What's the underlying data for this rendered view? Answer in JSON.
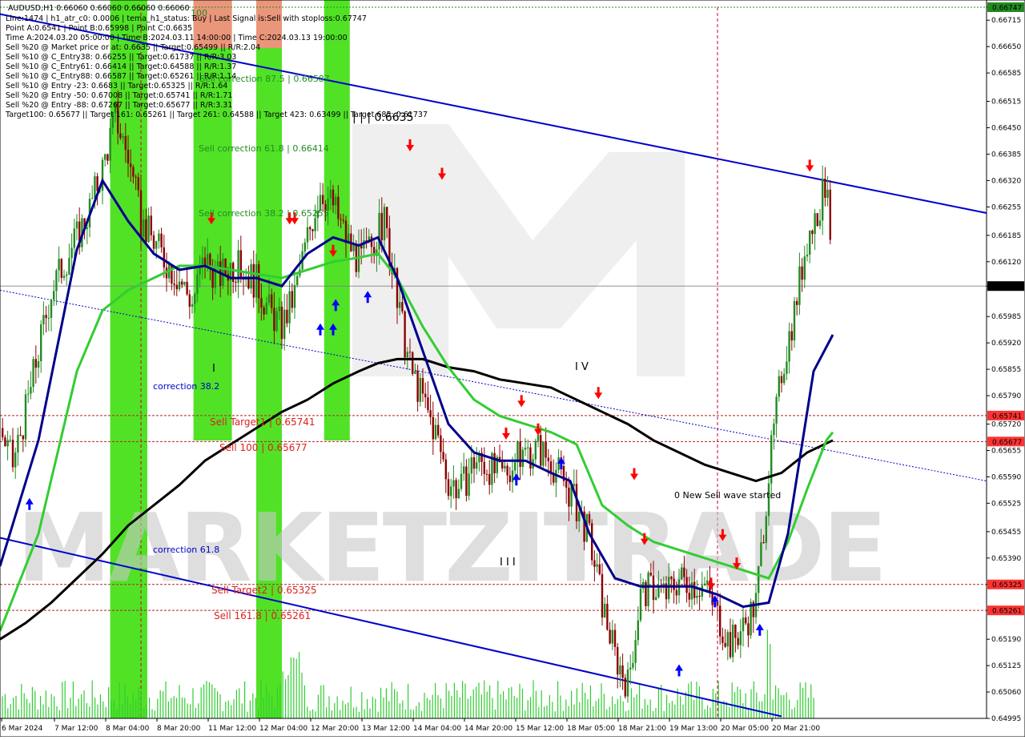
{
  "header": {
    "symbol": "AUDUSD,H1  0.66060 0.66060 0.66060 0.66060",
    "info_lines": [
      "Line:1474 | h1_atr_c0: 0.0006 | tema_h1_status: Buy | Last Signal is:Sell with stoploss:0.67747",
      "Point A:0.6541 | Point B:0.65998 | Point C:0.6635",
      "Time A:2024.03.20 05:00:00 | Time B:2024.03.11 14:00:00 | Time C:2024.03.13 19:00:00",
      "Sell %20 @ Market price or at: 0.6635 || Target:0.65499 || R/R:2.04",
      "Sell %10 @ C_Entry38: 0.66255 || Target:0.61737 || R/R:3.03",
      "Sell %10 @ C_Entry61: 0.66414 || Target:0.64588 || R/R:1.37",
      "Sell %10 @ C_Entry88: 0.66587 || Target:0.65261 || R/R:1.14",
      "Sell %10 @ Entry -23: 0.6683 || Target:0.65325 || R/R:1.64",
      "Sell %20 @ Entry -50: 0.67008 || Target:0.65741 || R/R:1.71",
      "Sell %20 @ Entry -88: 0.67267 || Target:0.65677 || R/R:3.31",
      "Target100: 0.65677 || Target 161: 0.65261 || Target 261: 0.64588 || Target 423: 0.63499 || Target 685: 0.61737"
    ]
  },
  "annotations": {
    "corr_875": "Sell correction 87.5 | 0.66587",
    "corr_618": "Sell correction 61.8 | 0.66414",
    "corr_382": "Sell correction 38.2 | 0.65255",
    "point_c": "| | | 0.6635",
    "label_100": "100",
    "correction_382": "correction 38.2",
    "correction_618": "correction 61.8",
    "sell_target1": "Sell Target1 | 0.65741",
    "sell_100": "Sell 100 | 0.65677",
    "sell_target2": "Sell Target2 | 0.65325",
    "sell_1618": "Sell 161.8 | 0.65261",
    "new_wave": "0 New Sell wave started",
    "wave_i": "I",
    "wave_iii": "I I I",
    "wave_iv": "I V"
  },
  "watermark": "MARKETZITRADE",
  "colors": {
    "up_candle": "#228b22",
    "down_candle": "#8b0000",
    "channel": "#0000cd",
    "green_zone": "#33dd00",
    "orange_zone": "#e9967a",
    "ma_fast": "#00008b",
    "ma_mid": "#32cd32",
    "ma_slow": "#000000",
    "level_line": "#b22222",
    "sell_arrow": "#ff0000",
    "buy_arrow": "#0000ff"
  },
  "chart_data": {
    "type": "candlestick",
    "symbol": "AUDUSD",
    "timeframe": "H1",
    "current_price": "0.66060",
    "ylim": [
      0.64995,
      0.66747
    ],
    "y_ticks": [
      "0.66747",
      "0.66715",
      "0.66650",
      "0.66585",
      "0.66515",
      "0.66450",
      "0.66385",
      "0.66320",
      "0.66255",
      "0.66185",
      "0.66120",
      "0.66060",
      "0.65985",
      "0.65920",
      "0.65855",
      "0.65790",
      "0.65720",
      "0.65655",
      "0.65590",
      "0.65525",
      "0.65455",
      "0.65390",
      "0.65325",
      "0.65261",
      "0.65190",
      "0.65125",
      "0.65060",
      "0.64995"
    ],
    "x_ticks": [
      "6 Mar 2024",
      "7 Mar 12:00",
      "8 Mar 04:00",
      "8 Mar 20:00",
      "11 Mar 12:00",
      "12 Mar 04:00",
      "12 Mar 20:00",
      "13 Mar 12:00",
      "14 Mar 04:00",
      "14 Mar 20:00",
      "15 Mar 12:00",
      "18 Mar 05:00",
      "18 Mar 21:00",
      "19 Mar 13:00",
      "20 Mar 05:00",
      "20 Mar 21:00"
    ],
    "highlighted_levels": [
      {
        "label": "0.66747",
        "value": 0.66747,
        "color": "#228b22"
      },
      {
        "label": "0.65741",
        "value": 0.65741,
        "color": "#ff3333"
      },
      {
        "label": "0.65677",
        "value": 0.65677,
        "color": "#ff3333"
      },
      {
        "label": "0.65325",
        "value": 0.65325,
        "color": "#ff3333"
      },
      {
        "label": "0.65261",
        "value": 0.65261,
        "color": "#ff3333"
      },
      {
        "label": "0.66060",
        "value": 0.6606,
        "color": "#000000"
      }
    ],
    "close_path": [
      [
        0.0,
        0.6571
      ],
      [
        1.0,
        0.6562
      ],
      [
        2.0,
        0.6575
      ],
      [
        3.0,
        0.659
      ],
      [
        4.0,
        0.6605
      ],
      [
        5.0,
        0.6612
      ],
      [
        6.0,
        0.6618
      ],
      [
        7.0,
        0.6625
      ],
      [
        8.0,
        0.6635
      ],
      [
        9.0,
        0.6648
      ],
      [
        10.0,
        0.6638
      ],
      [
        11.0,
        0.6622
      ],
      [
        12.0,
        0.6617
      ],
      [
        13.0,
        0.6612
      ],
      [
        14.0,
        0.6608
      ],
      [
        15.0,
        0.6602
      ],
      [
        16.0,
        0.6613
      ],
      [
        17.0,
        0.6608
      ],
      [
        18.0,
        0.6611
      ],
      [
        19.0,
        0.661
      ],
      [
        20.0,
        0.6607
      ],
      [
        21.0,
        0.66
      ],
      [
        22.0,
        0.6596
      ],
      [
        23.0,
        0.6604
      ],
      [
        24.0,
        0.6618
      ],
      [
        25.0,
        0.663
      ],
      [
        26.0,
        0.6626
      ],
      [
        27.0,
        0.6618
      ],
      [
        28.0,
        0.6612
      ],
      [
        29.0,
        0.6616
      ],
      [
        30.0,
        0.6622
      ],
      [
        31.0,
        0.6602
      ],
      [
        32.0,
        0.6586
      ],
      [
        33.0,
        0.6578
      ],
      [
        34.0,
        0.657
      ],
      [
        35.0,
        0.6558
      ],
      [
        36.0,
        0.6556
      ],
      [
        37.0,
        0.6563
      ],
      [
        38.0,
        0.6562
      ],
      [
        39.0,
        0.6559
      ],
      [
        40.0,
        0.6562
      ],
      [
        41.0,
        0.6565
      ],
      [
        42.0,
        0.6566
      ],
      [
        43.0,
        0.6563
      ],
      [
        44.0,
        0.6558
      ],
      [
        45.0,
        0.6552
      ],
      [
        46.0,
        0.6544
      ],
      [
        47.0,
        0.6528
      ],
      [
        48.0,
        0.6515
      ],
      [
        49.0,
        0.6508
      ],
      [
        50.0,
        0.653
      ],
      [
        51.0,
        0.6532
      ],
      [
        52.0,
        0.653
      ],
      [
        53.0,
        0.6534
      ],
      [
        54.0,
        0.6533
      ],
      [
        55.0,
        0.6532
      ],
      [
        56.0,
        0.6525
      ],
      [
        57.0,
        0.6518
      ],
      [
        58.0,
        0.6522
      ],
      [
        59.0,
        0.6528
      ],
      [
        60.0,
        0.656
      ],
      [
        61.0,
        0.6585
      ],
      [
        62.0,
        0.66
      ],
      [
        63.0,
        0.6618
      ],
      [
        64.0,
        0.6626
      ],
      [
        64.6,
        0.6633
      ],
      [
        65.0,
        0.6606
      ]
    ],
    "ma_fast": [
      [
        0.0,
        0.6537
      ],
      [
        3.0,
        0.6568
      ],
      [
        6.0,
        0.6615
      ],
      [
        8.0,
        0.6632
      ],
      [
        10.0,
        0.6622
      ],
      [
        12.0,
        0.6614
      ],
      [
        14.0,
        0.661
      ],
      [
        16.0,
        0.6611
      ],
      [
        18.0,
        0.6608
      ],
      [
        20.0,
        0.6608
      ],
      [
        22.0,
        0.6606
      ],
      [
        24.0,
        0.6614
      ],
      [
        26.0,
        0.6618
      ],
      [
        28.0,
        0.6616
      ],
      [
        29.5,
        0.6618
      ],
      [
        31.0,
        0.6608
      ],
      [
        33.0,
        0.659
      ],
      [
        35.0,
        0.6572
      ],
      [
        37.0,
        0.6565
      ],
      [
        39.0,
        0.6563
      ],
      [
        41.0,
        0.6563
      ],
      [
        43.0,
        0.656
      ],
      [
        44.5,
        0.6558
      ],
      [
        46.0,
        0.6545
      ],
      [
        48.0,
        0.6534
      ],
      [
        50.0,
        0.6532
      ],
      [
        52.0,
        0.6532
      ],
      [
        54.0,
        0.6532
      ],
      [
        56.0,
        0.653
      ],
      [
        58.0,
        0.6527
      ],
      [
        60.0,
        0.6528
      ],
      [
        61.5,
        0.6545
      ],
      [
        62.5,
        0.6565
      ],
      [
        63.5,
        0.6585
      ],
      [
        65.0,
        0.6594
      ]
    ],
    "ma_mid": [
      [
        0.0,
        0.6521
      ],
      [
        3.0,
        0.6545
      ],
      [
        6.0,
        0.6585
      ],
      [
        8.0,
        0.66
      ],
      [
        10.0,
        0.6605
      ],
      [
        12.0,
        0.6608
      ],
      [
        14.0,
        0.6611
      ],
      [
        16.0,
        0.6611
      ],
      [
        18.0,
        0.661
      ],
      [
        20.0,
        0.6609
      ],
      [
        22.0,
        0.6608
      ],
      [
        24.0,
        0.661
      ],
      [
        26.0,
        0.6612
      ],
      [
        28.0,
        0.6613
      ],
      [
        29.5,
        0.6614
      ],
      [
        31.0,
        0.6608
      ],
      [
        33.0,
        0.6596
      ],
      [
        35.0,
        0.6586
      ],
      [
        37.0,
        0.6578
      ],
      [
        39.0,
        0.6574
      ],
      [
        41.0,
        0.6572
      ],
      [
        43.0,
        0.657
      ],
      [
        45.0,
        0.6567
      ],
      [
        47.0,
        0.6552
      ],
      [
        49.0,
        0.6547
      ],
      [
        51.0,
        0.6543
      ],
      [
        53.0,
        0.6541
      ],
      [
        55.0,
        0.6539
      ],
      [
        57.0,
        0.6537
      ],
      [
        59.0,
        0.6535
      ],
      [
        60.0,
        0.6534
      ],
      [
        61.5,
        0.6543
      ],
      [
        63.0,
        0.6556
      ],
      [
        64.5,
        0.6568
      ],
      [
        65.0,
        0.657
      ]
    ],
    "ma_slow": [
      [
        0.0,
        0.6519
      ],
      [
        2.0,
        0.6523
      ],
      [
        4.0,
        0.6528
      ],
      [
        6.0,
        0.6534
      ],
      [
        8.0,
        0.654
      ],
      [
        10.0,
        0.6547
      ],
      [
        12.0,
        0.6552
      ],
      [
        14.0,
        0.6557
      ],
      [
        16.0,
        0.6563
      ],
      [
        18.0,
        0.6567
      ],
      [
        20.0,
        0.6571
      ],
      [
        22.0,
        0.6575
      ],
      [
        24.0,
        0.6578
      ],
      [
        26.0,
        0.6582
      ],
      [
        28.0,
        0.6585
      ],
      [
        29.5,
        0.6587
      ],
      [
        31.0,
        0.6588
      ],
      [
        33.0,
        0.6588
      ],
      [
        35.0,
        0.6586
      ],
      [
        37.0,
        0.6585
      ],
      [
        39.0,
        0.6583
      ],
      [
        41.0,
        0.6582
      ],
      [
        43.0,
        0.6581
      ],
      [
        45.0,
        0.6578
      ],
      [
        47.0,
        0.6575
      ],
      [
        49.0,
        0.6572
      ],
      [
        51.0,
        0.6568
      ],
      [
        53.0,
        0.6565
      ],
      [
        55.0,
        0.6562
      ],
      [
        57.0,
        0.656
      ],
      [
        59.0,
        0.6558
      ],
      [
        61.0,
        0.656
      ],
      [
        63.0,
        0.6565
      ],
      [
        65.0,
        0.6568
      ]
    ],
    "channel_upper": [
      [
        0.0,
        0.6673
      ],
      [
        77.0,
        0.6624
      ]
    ],
    "channel_lower": [
      [
        0.0,
        0.6544
      ],
      [
        61.0,
        0.65
      ]
    ],
    "channel_mid_dotted": [
      [
        0.0,
        0.6605
      ],
      [
        77.0,
        0.6558
      ]
    ],
    "green_zones": [
      [
        8.6,
        11.5
      ],
      [
        15.1,
        18.1
      ],
      [
        20.0,
        22.0
      ],
      [
        25.3,
        27.3
      ]
    ],
    "orange_zones": [
      [
        15.1,
        18.1
      ],
      [
        20.0,
        22.0
      ]
    ],
    "vertical_markers": [
      11.0,
      56.0
    ],
    "sell_arrows": [
      [
        16.5,
        0.662
      ],
      [
        22.6,
        0.662
      ],
      [
        23.0,
        0.662
      ],
      [
        26.0,
        0.6612
      ],
      [
        32.0,
        0.6638
      ],
      [
        34.5,
        0.6631
      ],
      [
        39.5,
        0.6567
      ],
      [
        40.7,
        0.6575
      ],
      [
        42.0,
        0.6568
      ],
      [
        46.7,
        0.6577
      ],
      [
        49.5,
        0.6557
      ],
      [
        50.3,
        0.6541
      ],
      [
        56.4,
        0.6542
      ],
      [
        57.5,
        0.6535
      ],
      [
        55.5,
        0.653
      ],
      [
        63.2,
        0.6633
      ]
    ],
    "buy_arrows": [
      [
        2.3,
        0.6555
      ],
      [
        25.0,
        0.6598
      ],
      [
        26.0,
        0.6598
      ],
      [
        26.2,
        0.6604
      ],
      [
        28.7,
        0.6606
      ],
      [
        40.3,
        0.6561
      ],
      [
        43.8,
        0.6565
      ],
      [
        53.0,
        0.6514
      ],
      [
        55.8,
        0.6531
      ],
      [
        59.3,
        0.6524
      ]
    ]
  }
}
